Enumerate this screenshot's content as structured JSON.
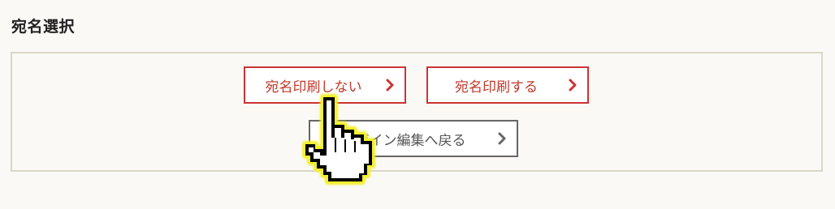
{
  "section": {
    "title": "宛名選択"
  },
  "buttons": {
    "no_print": "宛名印刷しない",
    "print": "宛名印刷する",
    "back": "デザイン編集へ戻る"
  },
  "icons": {
    "chevron": "chevron-right-icon",
    "cursor": "hand-pointer-cursor-icon"
  },
  "colors": {
    "accent_red": "#cc3333",
    "neutral_gray": "#666666",
    "panel_border": "#dcd6c8",
    "background": "#faf9f6"
  }
}
